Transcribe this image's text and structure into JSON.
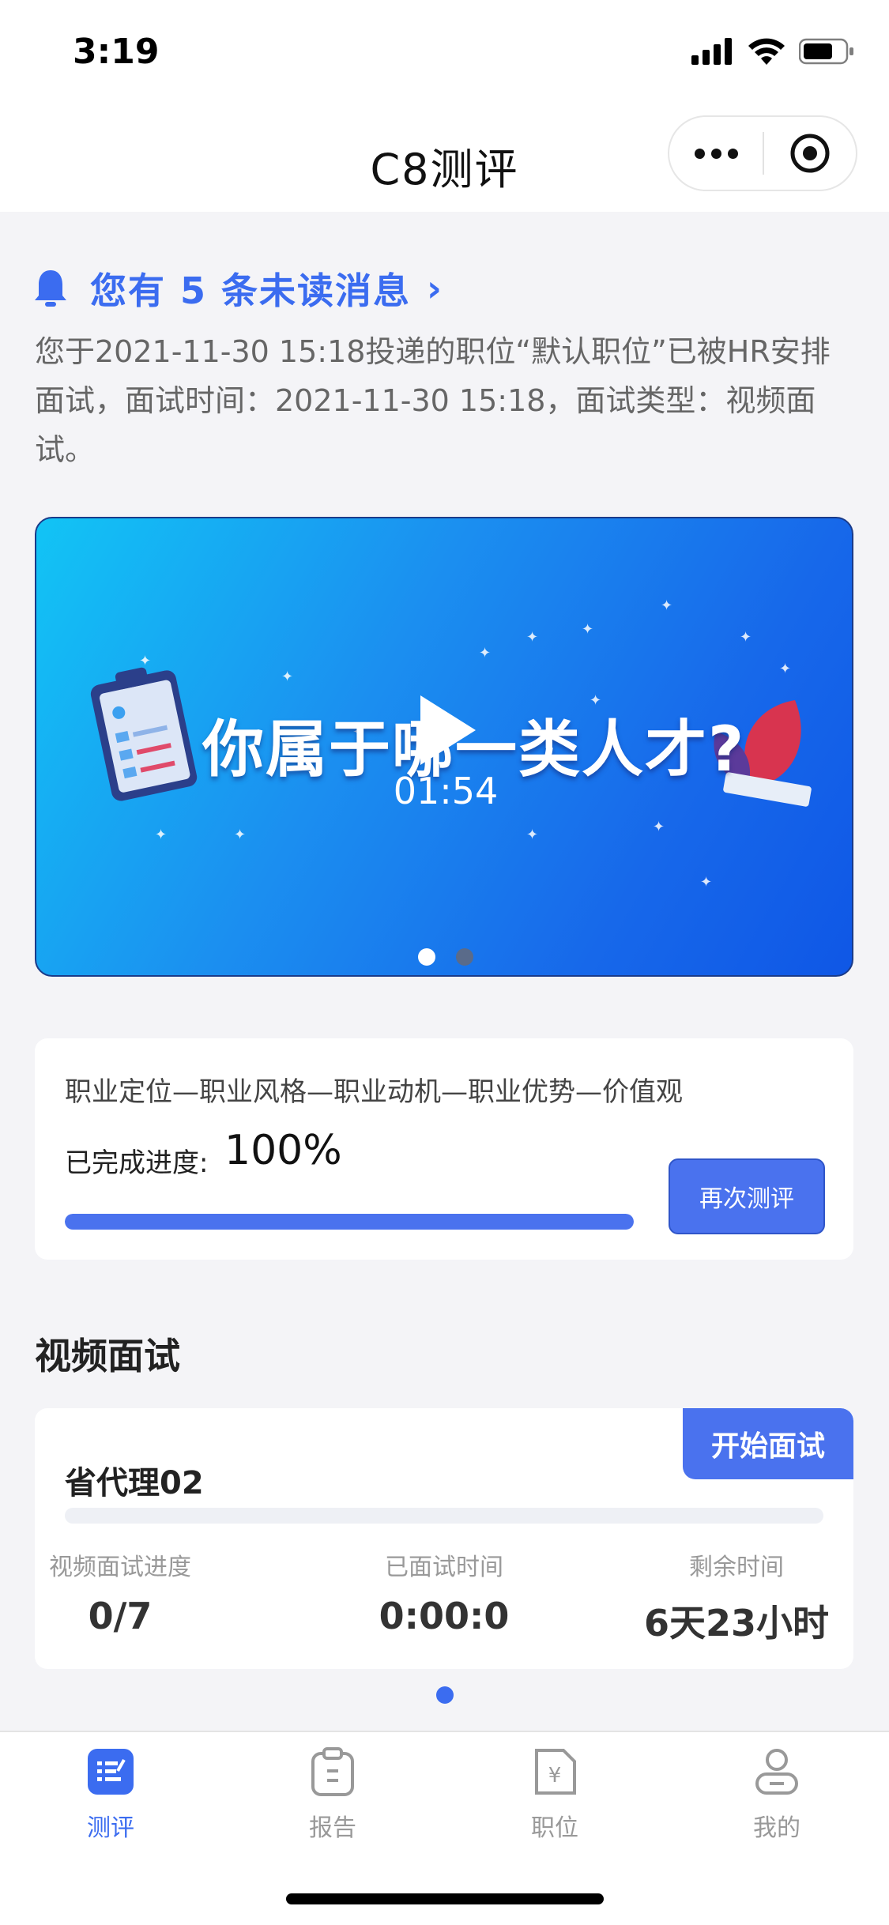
{
  "status": {
    "time": "3:19"
  },
  "nav": {
    "title": "C8测评"
  },
  "notice": {
    "title": "您有 5 条未读消息",
    "body": "您于2021-11-30 15:18投递的职位“默认职位”已被HR安排面试，面试时间：2021-11-30 15:18，面试类型：视频面试。"
  },
  "banner": {
    "headline": "你属于哪一类人才?",
    "duration": "01:54",
    "slide_count": 2,
    "active_slide": 0
  },
  "assessment": {
    "steps": "职业定位—职业风格—职业动机—职业优势—价值观",
    "progress_label": "已完成进度:",
    "progress_value": "100%",
    "progress_fraction": 1.0,
    "retest_label": "再次测评"
  },
  "video_interview": {
    "section_title": "视频面试",
    "name": "省代理02",
    "start_label": "开始面试",
    "progress_fraction": 0,
    "stats": [
      {
        "label": "视频面试进度",
        "value": "0/7"
      },
      {
        "label": "已面试时间",
        "value": "0:00:0"
      },
      {
        "label": "剩余时间",
        "value": "6天23小时"
      }
    ]
  },
  "tabs": [
    {
      "label": "测评",
      "icon": "assessment-icon",
      "active": true
    },
    {
      "label": "报告",
      "icon": "report-icon",
      "active": false
    },
    {
      "label": "职位",
      "icon": "position-icon",
      "active": false
    },
    {
      "label": "我的",
      "icon": "profile-icon",
      "active": false
    }
  ],
  "colors": {
    "accent": "#4a72ee",
    "notice": "#3b6cf0",
    "background": "#f4f4f7"
  }
}
